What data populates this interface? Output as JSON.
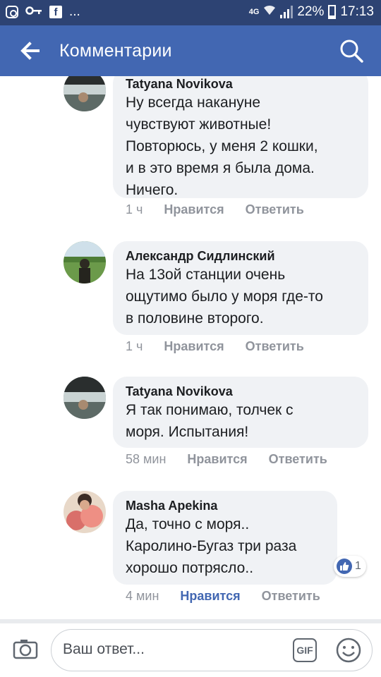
{
  "status_bar": {
    "network": "4G",
    "battery": "22%",
    "time": "17:13",
    "dots": "..."
  },
  "app_bar": {
    "title": "Комментарии"
  },
  "comments": [
    {
      "author": "Tatyana Novikova",
      "text_lines": [
        "Ну всегда накануне",
        "чувствуют животные!",
        "Повторюсь, у меня 2 кошки,",
        "и в это время я была дома.",
        "Ничего."
      ],
      "time": "1 ч",
      "like": "Нравится",
      "reply": "Ответить",
      "liked": false
    },
    {
      "author": "Александр Сидлинский",
      "text_lines": [
        "На 13ой станции очень",
        "ощутимо было у моря где-то",
        "в половине второго."
      ],
      "time": "1 ч",
      "like": "Нравится",
      "reply": "Ответить",
      "liked": false
    },
    {
      "author": "Tatyana Novikova",
      "text_lines": [
        "Я так понимаю, толчек с",
        "моря. Испытания!"
      ],
      "time": "58 мин",
      "like": "Нравится",
      "reply": "Ответить",
      "liked": false
    },
    {
      "author": "Masha Apekina",
      "text_lines": [
        "Да, точно с моря..",
        "Каролино-Бугаз три раза",
        "хорошо потрясло.."
      ],
      "time": "4 мин",
      "like": "Нравится",
      "reply": "Ответить",
      "liked": true,
      "reaction_count": "1"
    }
  ],
  "composer": {
    "placeholder": "Ваш ответ...",
    "gif_label": "GIF"
  },
  "colors": {
    "status_bar": "#2d4373",
    "app_bar": "#4267b2",
    "bubble": "#f0f2f5",
    "meta_text": "#90949c",
    "liked": "#4267b2"
  }
}
